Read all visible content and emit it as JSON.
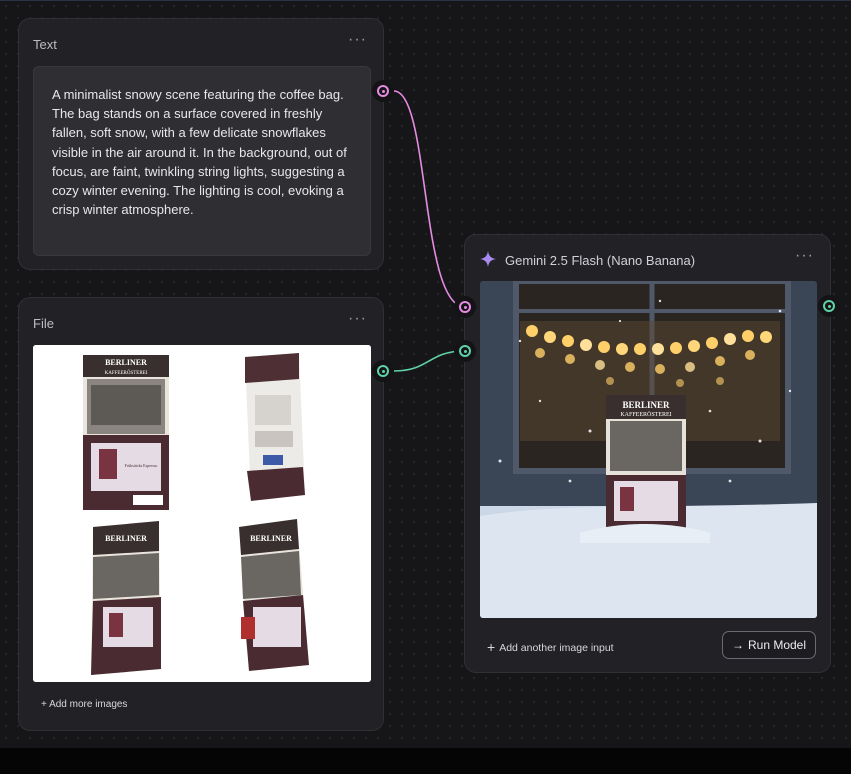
{
  "text_node": {
    "title": "Text",
    "menu": "···",
    "prompt": "A minimalist snowy scene featuring the coffee bag. The bag stands on a surface covered in freshly fallen, soft snow, with a few delicate snowflakes visible in the air around it. In the background, out of focus, are faint, twinkling string lights, suggesting a cozy winter evening. The lighting is cool, evoking a crisp winter atmosphere."
  },
  "file_node": {
    "title": "File",
    "menu": "···",
    "add_more_label": "+ Add more images",
    "bag_brand_line1": "BERLINER",
    "bag_brand_line2": "KAFFEERÖSTEREI",
    "bag_product": "Frühstücks Espresso"
  },
  "gemini_node": {
    "title": "Gemini 2.5 Flash (Nano Banana)",
    "menu": "···",
    "add_input_label": "Add another image input",
    "run_label": "Run Model",
    "run_icon": "→"
  },
  "colors": {
    "text_wire": "#e58be3",
    "file_wire": "#5fd3a8",
    "node_bg": "#222226",
    "canvas_bg": "#161618"
  }
}
